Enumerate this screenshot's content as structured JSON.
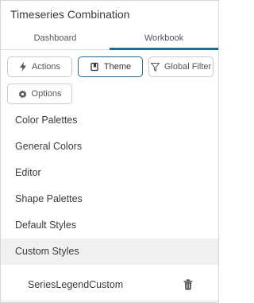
{
  "panel": {
    "title": "Timeseries Combination"
  },
  "tabs": [
    {
      "label": "Dashboard",
      "active": false
    },
    {
      "label": "Workbook",
      "active": true
    }
  ],
  "toolbar": {
    "actions": {
      "label": "Actions",
      "icon": "lightning-icon"
    },
    "theme": {
      "label": "Theme",
      "icon": "theme-icon",
      "active": true
    },
    "global_filter": {
      "label": "Global Filter",
      "icon": "filter-icon"
    },
    "options": {
      "label": "Options",
      "icon": "gear-icon"
    }
  },
  "theme_menu": [
    {
      "label": "Color Palettes"
    },
    {
      "label": "General Colors"
    },
    {
      "label": "Editor"
    },
    {
      "label": "Shape Palettes"
    },
    {
      "label": "Default Styles"
    },
    {
      "label": "Custom Styles",
      "selected": true
    }
  ],
  "custom_styles": [
    {
      "label": "SeriesLegendCustom",
      "action_icon": "trash-icon"
    }
  ],
  "colors": {
    "accent": "#1e6c8f",
    "selected_bg": "#f0f0f0",
    "border": "#c9c9c9"
  }
}
